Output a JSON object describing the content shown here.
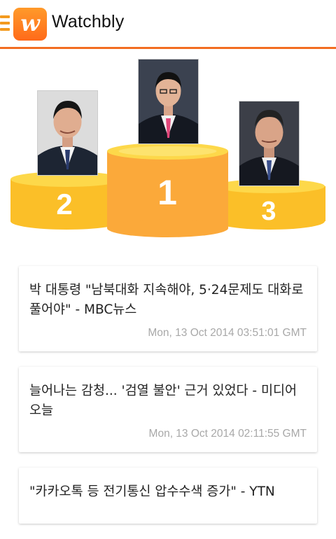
{
  "app": {
    "title": "Watchbly",
    "logo_letter": "w",
    "accent_color": "#f26d21",
    "logo_color": "#ff7a22",
    "menu_icon": "hamburger-icon"
  },
  "podium": {
    "colors": {
      "gold": "#fbcb1e",
      "orange": "#fba93a"
    },
    "places": [
      {
        "rank": "1",
        "photo": "person-photo"
      },
      {
        "rank": "2",
        "photo": "person-photo"
      },
      {
        "rank": "3",
        "photo": "person-photo"
      }
    ]
  },
  "news": [
    {
      "title": "박 대통령 \"남북대화 지속해야, 5·24문제도 대화로 풀어야\" - MBC뉴스",
      "time": "Mon, 13 Oct 2014 03:51:01 GMT"
    },
    {
      "title": "늘어나는 감청... '검열 불안' 근거 있었다 - 미디어오늘",
      "time": "Mon, 13 Oct 2014 02:11:55 GMT"
    },
    {
      "title": "\"카카오톡 등 전기통신 압수수색 증가\" - YTN",
      "time": ""
    }
  ]
}
